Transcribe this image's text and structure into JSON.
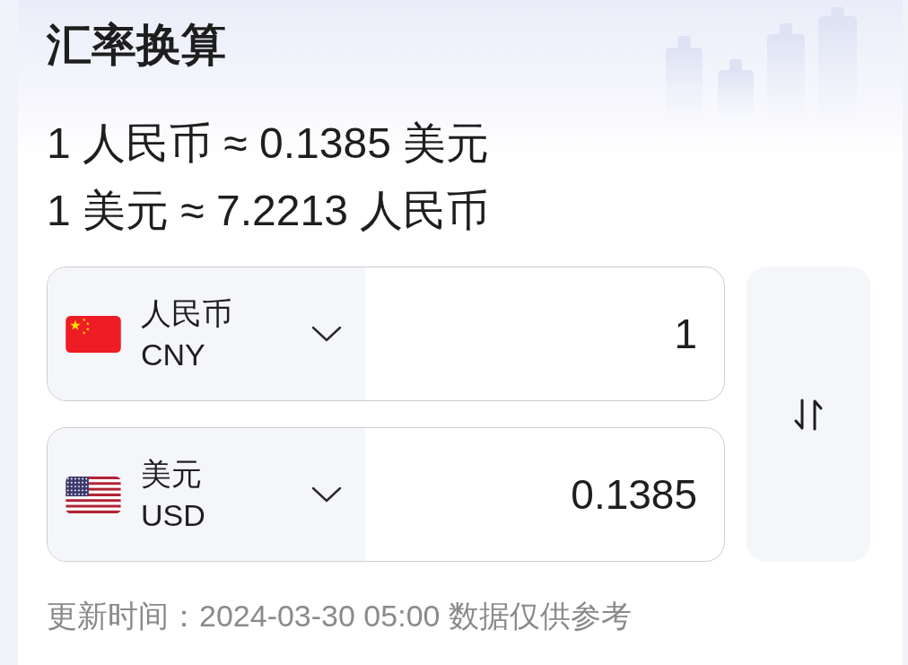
{
  "title": "汇率换算",
  "rates": [
    "1 人民币 ≈ 0.1385 美元",
    "1 美元 ≈ 7.2213 人民币"
  ],
  "currencies": [
    {
      "kind": "china",
      "name": "人民币",
      "code": "CNY",
      "amount": "1"
    },
    {
      "kind": "usa",
      "name": "美元",
      "code": "USD",
      "amount": "0.1385"
    }
  ],
  "footer": "更新时间：2024-03-30 05:00 数据仅供参考"
}
